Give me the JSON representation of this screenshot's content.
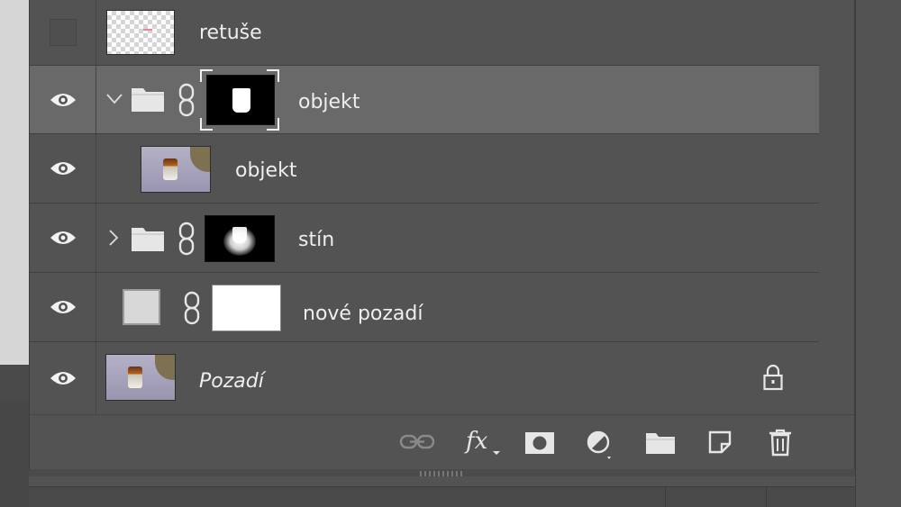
{
  "layers_panel": {
    "layers": [
      {
        "name": "retuše",
        "visible": false,
        "type": "pixel-transparent",
        "thumbnail": "checkerboard"
      },
      {
        "name": "objekt",
        "visible": true,
        "type": "group",
        "expanded": true,
        "selected": true,
        "has_mask": true,
        "mask": "black-with-white-jar"
      },
      {
        "name": "objekt",
        "visible": true,
        "type": "pixel",
        "indented": true,
        "thumbnail": "photo-jar"
      },
      {
        "name": "stín",
        "visible": true,
        "type": "group",
        "expanded": false,
        "has_mask": true,
        "mask": "black-with-white-shadow"
      },
      {
        "name": "nové pozadí",
        "visible": true,
        "type": "fill",
        "fill_color": "#d8d8d8",
        "has_mask": true,
        "mask": "white"
      },
      {
        "name": "Pozadí",
        "visible": true,
        "type": "background",
        "locked": true,
        "italic": true,
        "thumbnail": "photo-jar"
      }
    ],
    "bottom_toolbar": [
      {
        "icon": "link-layers-icon",
        "enabled": false
      },
      {
        "icon": "fx-icon",
        "label": "fx"
      },
      {
        "icon": "add-mask-icon"
      },
      {
        "icon": "adjustment-layer-icon"
      },
      {
        "icon": "new-group-icon"
      },
      {
        "icon": "new-layer-icon"
      },
      {
        "icon": "delete-layer-icon"
      }
    ]
  },
  "colors": {
    "panel_bg": "#535353",
    "selected_row": "#696969",
    "text": "#eeeeee",
    "canvas": "#d6d6d6"
  }
}
